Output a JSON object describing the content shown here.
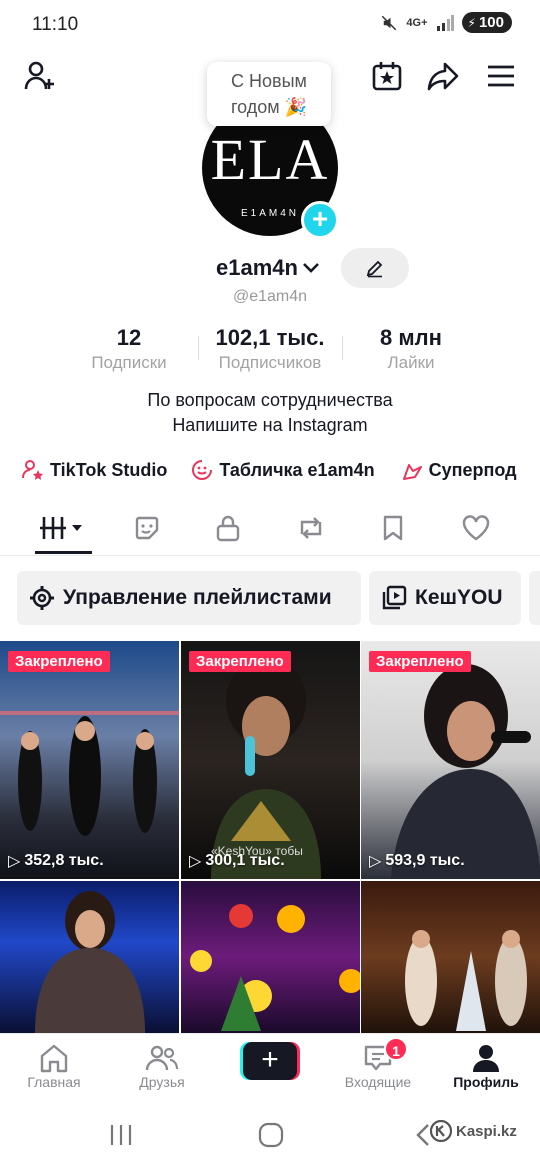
{
  "status_bar": {
    "time": "11:10",
    "network": "4G+",
    "battery": "100"
  },
  "tooltip": {
    "line1": "С Новым",
    "line2": "годом 🎉"
  },
  "avatar": {
    "big_text": "ELA",
    "small_text": "E1AM4N"
  },
  "profile": {
    "username": "e1am4n",
    "handle": "@e1am4n",
    "bio_line1": "По вопросам сотрудничества",
    "bio_line2": "Напишите на Instagram"
  },
  "stats": [
    {
      "value": "12",
      "label": "Подписки"
    },
    {
      "value": "102,1 тыс.",
      "label": "Подписчиков"
    },
    {
      "value": "8 млн",
      "label": "Лайки"
    }
  ],
  "links": [
    {
      "label": "TikTok Studio",
      "icon": "user-star-icon"
    },
    {
      "label": "Табличка e1am4n",
      "icon": "sticker-icon"
    },
    {
      "label": "Суперпод",
      "icon": "hearts-icon"
    }
  ],
  "tabs": [
    "videos",
    "stickers",
    "private",
    "reposts",
    "favorites",
    "liked"
  ],
  "chips": [
    {
      "label": "Управление плейлистами",
      "icon": "gear-icon"
    },
    {
      "label": "КешYOU",
      "icon": "playlist-icon"
    }
  ],
  "videos": [
    {
      "pinned": "Закреплено",
      "views": "352,8 тыс."
    },
    {
      "pinned": "Закреплено",
      "views": "300,1 тыс.",
      "overlay_text": "«KeshYou» тобы"
    },
    {
      "pinned": "Закреплено",
      "views": "593,9 тыс."
    },
    {
      "pinned": "",
      "views": ""
    },
    {
      "pinned": "",
      "views": ""
    },
    {
      "pinned": "",
      "views": ""
    }
  ],
  "bottom_nav": {
    "home": "Главная",
    "friends": "Друзья",
    "inbox": "Входящие",
    "inbox_badge": "1",
    "profile": "Профиль"
  },
  "watermark": "Kaspi.kz",
  "colors": {
    "accent": "#fe2c55",
    "cyan": "#25f4ee",
    "badge_blue": "#20d5ec"
  }
}
